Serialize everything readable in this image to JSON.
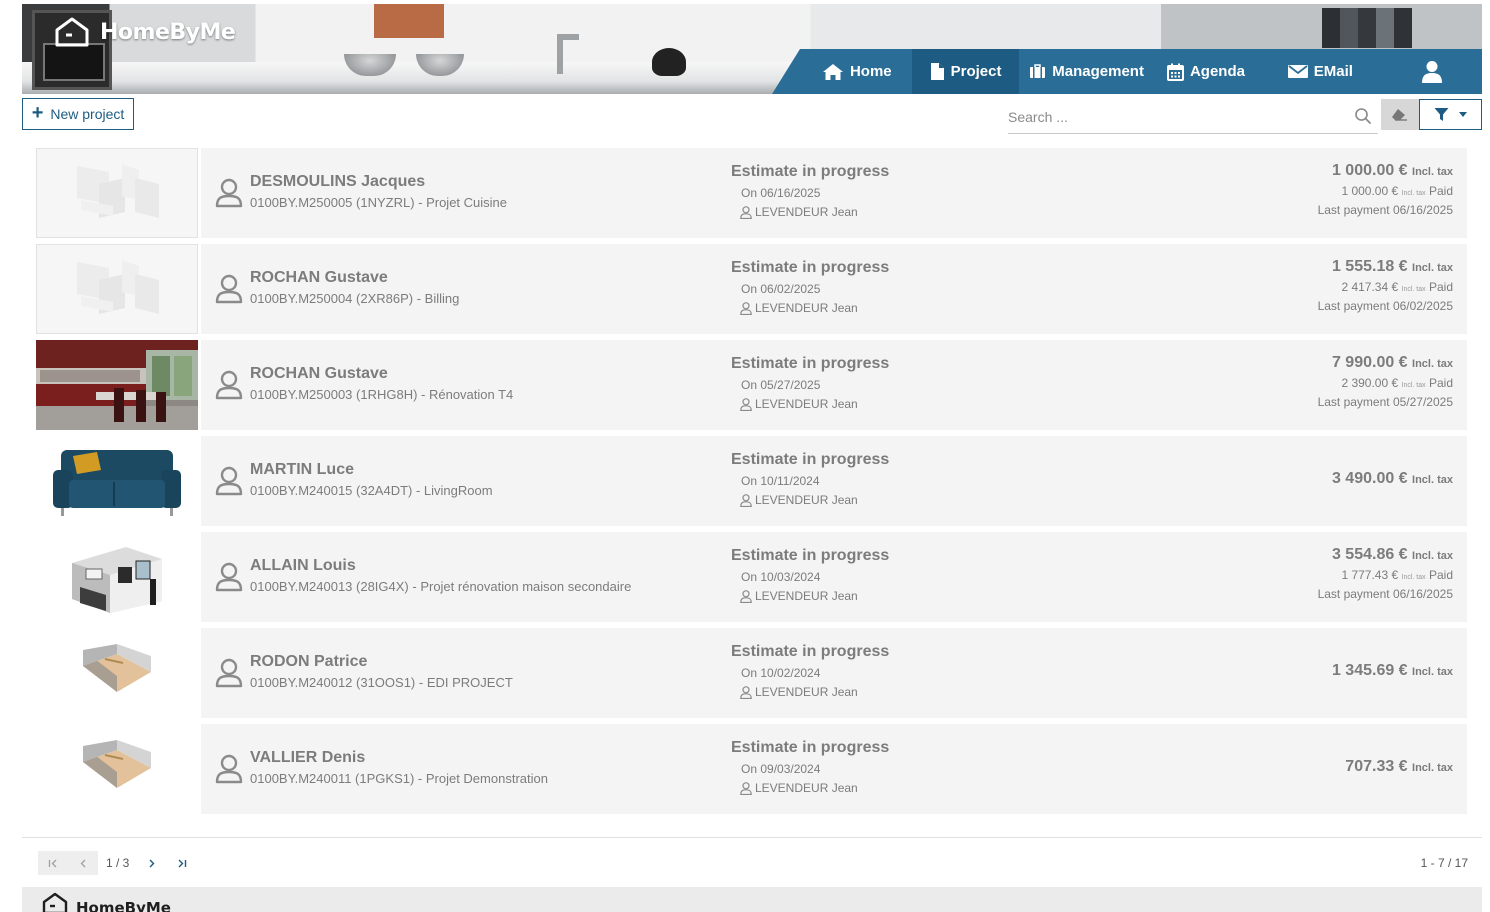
{
  "brand": {
    "name": "HomeByMe",
    "accent": "#2a6e97",
    "accent_dark": "#1d5b82"
  },
  "nav": {
    "home": "Home",
    "project": "Project",
    "management": "Management",
    "agenda": "Agenda",
    "email": "EMail",
    "active": "Project"
  },
  "toolbar": {
    "new_project": "New project",
    "search_placeholder": "Search ..."
  },
  "projects": [
    {
      "client": "DESMOULINS Jacques",
      "ref": "0100BY.M250005 (1NYZRL) - Projet Cuisine",
      "status": "Estimate in progress",
      "date": "On 06/16/2025",
      "seller": "LEVENDEUR Jean",
      "amount": "1 000.00 €",
      "amount_tax": "Incl. tax",
      "paid_amount": "1 000.00 €",
      "paid_tax": "Incl. tax",
      "paid_label": "Paid",
      "last_payment": "Last payment 06/16/2025",
      "thumb": "placeholder"
    },
    {
      "client": "ROCHAN Gustave",
      "ref": "0100BY.M250004 (2XR86P) - Billing",
      "status": "Estimate in progress",
      "date": "On 06/02/2025",
      "seller": "LEVENDEUR Jean",
      "amount": "1 555.18 €",
      "amount_tax": "Incl. tax",
      "paid_amount": "2 417.34 €",
      "paid_tax": "Incl. tax",
      "paid_label": "Paid",
      "last_payment": "Last payment 06/02/2025",
      "thumb": "placeholder"
    },
    {
      "client": "ROCHAN Gustave",
      "ref": "0100BY.M250003 (1RHG8H) - Rénovation T4",
      "status": "Estimate in progress",
      "date": "On 05/27/2025",
      "seller": "LEVENDEUR Jean",
      "amount": "7 990.00 €",
      "amount_tax": "Incl. tax",
      "paid_amount": "2 390.00 €",
      "paid_tax": "Incl. tax",
      "paid_label": "Paid",
      "last_payment": "Last payment 05/27/2025",
      "thumb": "kitchen"
    },
    {
      "client": "MARTIN Luce",
      "ref": "0100BY.M240015 (32A4DT) - LivingRoom",
      "status": "Estimate in progress",
      "date": "On 10/11/2024",
      "seller": "LEVENDEUR Jean",
      "amount": "3 490.00 €",
      "amount_tax": "Incl. tax",
      "thumb": "sofa"
    },
    {
      "client": "ALLAIN Louis",
      "ref": "0100BY.M240013 (28IG4X) - Projet rénovation maison secondaire",
      "status": "Estimate in progress",
      "date": "On 10/03/2024",
      "seller": "LEVENDEUR Jean",
      "amount": "3 554.86 €",
      "amount_tax": "Incl. tax",
      "paid_amount": "1 777.43 €",
      "paid_tax": "Incl. tax",
      "paid_label": "Paid",
      "last_payment": "Last payment 06/16/2025",
      "thumb": "room3d"
    },
    {
      "client": "RODON Patrice",
      "ref": "0100BY.M240012 (31OOS1) - EDI PROJECT",
      "status": "Estimate in progress",
      "date": "On 10/02/2024",
      "seller": "LEVENDEUR Jean",
      "amount": "1 345.69 €",
      "amount_tax": "Incl. tax",
      "thumb": "emptyroom"
    },
    {
      "client": "VALLIER Denis",
      "ref": "0100BY.M240011 (1PGKS1) - Projet Demonstration",
      "status": "Estimate in progress",
      "date": "On 09/03/2024",
      "seller": "LEVENDEUR Jean",
      "amount": "707.33 €",
      "amount_tax": "Incl. tax",
      "thumb": "emptyroom"
    }
  ],
  "pagination": {
    "page": "1 / 3",
    "range": "1 - 7 / 17"
  },
  "footer": {
    "brand": "HomeByMe"
  }
}
